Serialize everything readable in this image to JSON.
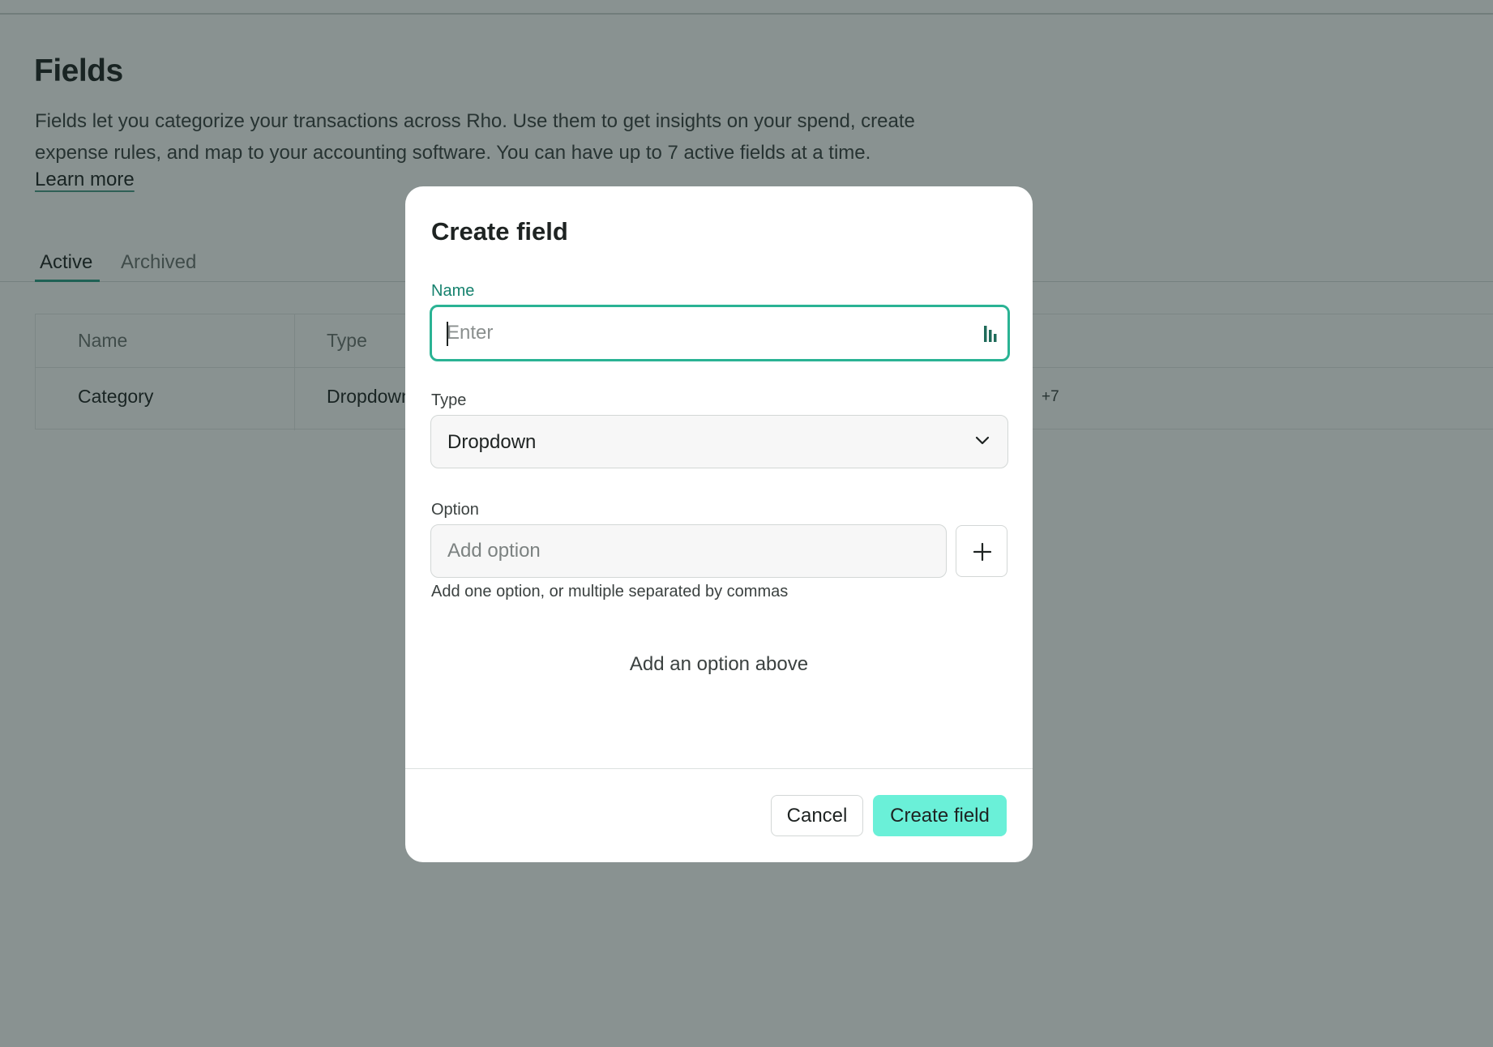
{
  "page": {
    "title": "Fields",
    "description": "Fields let you categorize your transactions across Rho. Use them to get insights on your spend, create expense rules, and map to your accounting software. You can have up to 7 active fields at a time.",
    "learn_more": "Learn more"
  },
  "tabs": [
    {
      "label": "Active",
      "active": true
    },
    {
      "label": "Archived",
      "active": false
    }
  ],
  "table": {
    "columns": [
      "Name",
      "Type"
    ],
    "rows": [
      {
        "name": "Category",
        "type": "Dropdown",
        "more": "+7"
      }
    ]
  },
  "modal": {
    "title": "Create field",
    "name_label": "Name",
    "name_placeholder": "Enter",
    "name_value": "",
    "type_label": "Type",
    "type_value": "Dropdown",
    "option_label": "Option",
    "option_placeholder": "Add option",
    "option_value": "",
    "helper": "Add one option, or multiple separated by commas",
    "empty_state": "Add an option above",
    "cancel_label": "Cancel",
    "create_label": "Create field"
  },
  "icons": {
    "add": "plus-icon",
    "select": "chevron-down-icon",
    "input_extension": "password-manager-icon"
  },
  "colors": {
    "accent": "#2ab394",
    "primary_button": "#6af0d8",
    "label_accent": "#16826e"
  }
}
